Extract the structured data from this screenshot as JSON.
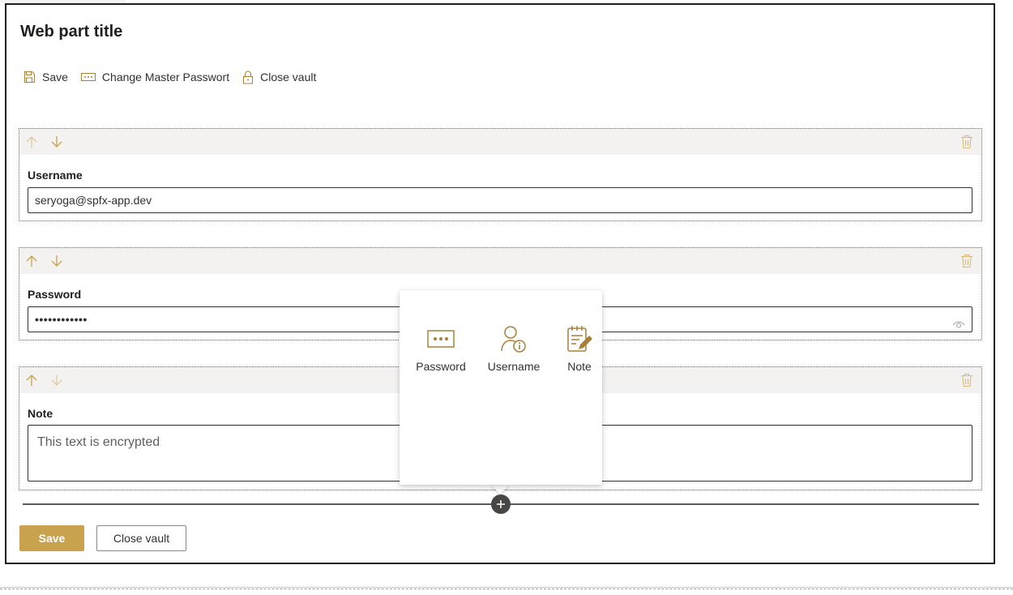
{
  "webpart": {
    "title": "Web part title"
  },
  "commandbar": {
    "save_label": "Save",
    "change_master_label": "Change Master Passwort",
    "close_vault_label": "Close vault"
  },
  "blocks": {
    "username": {
      "label": "Username",
      "value": "seryoga@spfx-app.dev"
    },
    "password": {
      "label": "Password",
      "masked_value": "••••••••••••"
    },
    "note": {
      "label": "Note",
      "value": "This text is encrypted"
    }
  },
  "add_menu": {
    "items": [
      {
        "label": "Password",
        "icon": "password-icon"
      },
      {
        "label": "Username",
        "icon": "user-info-icon"
      },
      {
        "label": "Note",
        "icon": "note-icon"
      }
    ]
  },
  "footer": {
    "save_label": "Save",
    "close_vault_label": "Close vault"
  },
  "colors": {
    "accent": "#c8a24c",
    "icon_accent": "#a9803a",
    "toolbar_bg": "#f3f2f1",
    "add_button": "#484644"
  }
}
